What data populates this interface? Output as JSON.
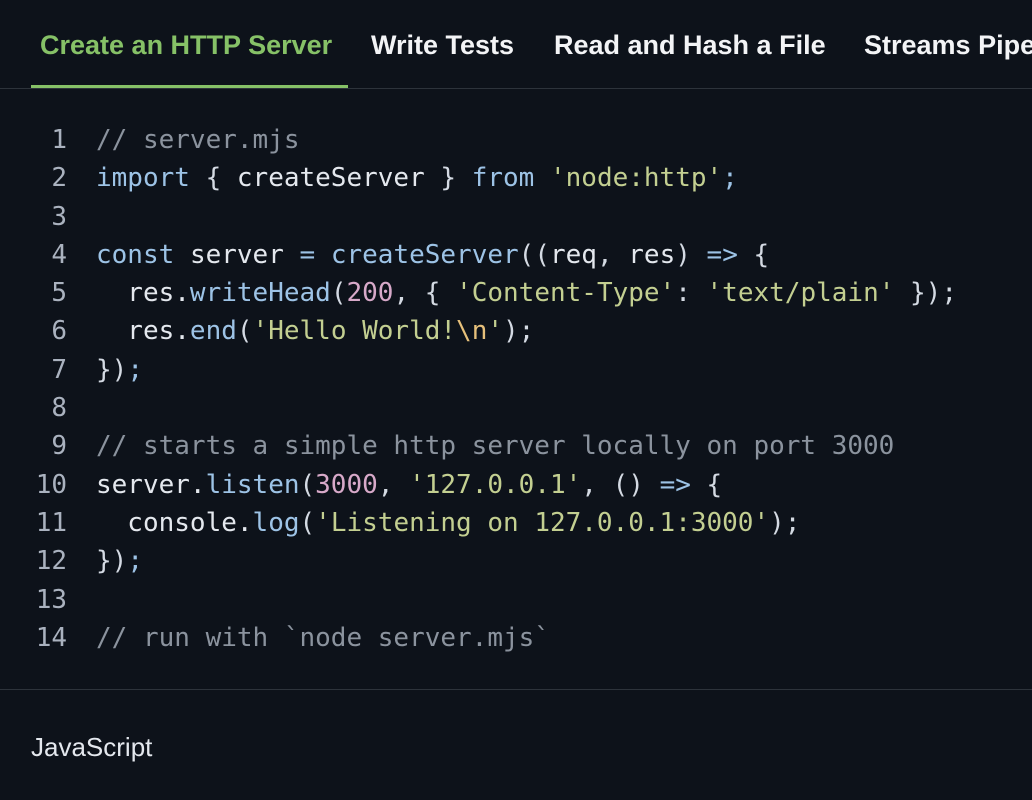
{
  "tabs": [
    {
      "label": "Create an HTTP Server",
      "active": true
    },
    {
      "label": "Write Tests",
      "active": false
    },
    {
      "label": "Read and Hash a File",
      "active": false
    },
    {
      "label": "Streams Pipeline",
      "active": false
    }
  ],
  "code": {
    "lines": [
      {
        "n": "1",
        "tokens": [
          {
            "t": "// server.mjs",
            "k": "com"
          }
        ]
      },
      {
        "n": "2",
        "tokens": [
          {
            "t": "import",
            "k": "kw"
          },
          {
            "t": " { ",
            "k": "pn"
          },
          {
            "t": "createServer",
            "k": "id"
          },
          {
            "t": " } ",
            "k": "pn"
          },
          {
            "t": "from",
            "k": "kw"
          },
          {
            "t": " ",
            "k": "pn"
          },
          {
            "t": "'node:http'",
            "k": "str"
          },
          {
            "t": ";",
            "k": "op"
          }
        ]
      },
      {
        "n": "3",
        "tokens": []
      },
      {
        "n": "4",
        "tokens": [
          {
            "t": "const",
            "k": "kw"
          },
          {
            "t": " ",
            "k": "pn"
          },
          {
            "t": "server",
            "k": "id"
          },
          {
            "t": " ",
            "k": "pn"
          },
          {
            "t": "=",
            "k": "op"
          },
          {
            "t": " ",
            "k": "pn"
          },
          {
            "t": "createServer",
            "k": "fn"
          },
          {
            "t": "((",
            "k": "pn"
          },
          {
            "t": "req",
            "k": "id"
          },
          {
            "t": ", ",
            "k": "pn"
          },
          {
            "t": "res",
            "k": "id"
          },
          {
            "t": ") ",
            "k": "pn"
          },
          {
            "t": "=>",
            "k": "op"
          },
          {
            "t": " {",
            "k": "pn"
          }
        ]
      },
      {
        "n": "5",
        "tokens": [
          {
            "t": "  res.",
            "k": "id"
          },
          {
            "t": "writeHead",
            "k": "fn"
          },
          {
            "t": "(",
            "k": "pn"
          },
          {
            "t": "200",
            "k": "num"
          },
          {
            "t": ", { ",
            "k": "pn"
          },
          {
            "t": "'Content-Type'",
            "k": "str"
          },
          {
            "t": ": ",
            "k": "pn"
          },
          {
            "t": "'text/plain'",
            "k": "str"
          },
          {
            "t": " });",
            "k": "pn"
          }
        ]
      },
      {
        "n": "6",
        "tokens": [
          {
            "t": "  res.",
            "k": "id"
          },
          {
            "t": "end",
            "k": "fn"
          },
          {
            "t": "(",
            "k": "pn"
          },
          {
            "t": "'Hello World!",
            "k": "str"
          },
          {
            "t": "\\n",
            "k": "esc"
          },
          {
            "t": "'",
            "k": "str"
          },
          {
            "t": ");",
            "k": "pn"
          }
        ]
      },
      {
        "n": "7",
        "tokens": [
          {
            "t": "})",
            "k": "pn"
          },
          {
            "t": ";",
            "k": "op"
          }
        ]
      },
      {
        "n": "8",
        "tokens": []
      },
      {
        "n": "9",
        "tokens": [
          {
            "t": "// starts a simple http server locally on port 3000",
            "k": "com"
          }
        ]
      },
      {
        "n": "10",
        "tokens": [
          {
            "t": "server.",
            "k": "id"
          },
          {
            "t": "listen",
            "k": "fn"
          },
          {
            "t": "(",
            "k": "pn"
          },
          {
            "t": "3000",
            "k": "num"
          },
          {
            "t": ", ",
            "k": "pn"
          },
          {
            "t": "'127.0.0.1'",
            "k": "str"
          },
          {
            "t": ", () ",
            "k": "pn"
          },
          {
            "t": "=>",
            "k": "op"
          },
          {
            "t": " {",
            "k": "pn"
          }
        ]
      },
      {
        "n": "11",
        "tokens": [
          {
            "t": "  console.",
            "k": "id"
          },
          {
            "t": "log",
            "k": "fn"
          },
          {
            "t": "(",
            "k": "pn"
          },
          {
            "t": "'Listening on 127.0.0.1:3000'",
            "k": "str"
          },
          {
            "t": ");",
            "k": "pn"
          }
        ]
      },
      {
        "n": "12",
        "tokens": [
          {
            "t": "})",
            "k": "pn"
          },
          {
            "t": ";",
            "k": "op"
          }
        ]
      },
      {
        "n": "13",
        "tokens": []
      },
      {
        "n": "14",
        "tokens": [
          {
            "t": "// run with `node server.mjs`",
            "k": "com"
          }
        ]
      }
    ]
  },
  "footer": {
    "language": "JavaScript"
  },
  "colors": {
    "accent": "#86c167",
    "background": "#0d121a",
    "divider": "#2d333b"
  }
}
